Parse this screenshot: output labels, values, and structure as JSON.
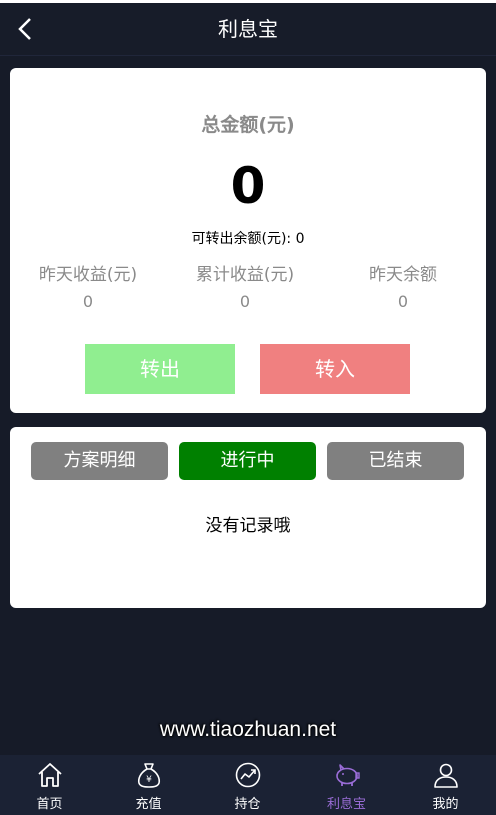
{
  "header": {
    "title": "利息宝"
  },
  "summary": {
    "total_label": "总金额(元)",
    "total_value": "0",
    "transferable_label": "可转出余额(元): 0"
  },
  "stats": [
    {
      "label": "昨天收益(元)",
      "value": "0"
    },
    {
      "label": "累计收益(元)",
      "value": "0"
    },
    {
      "label": "昨天余额",
      "value": "0"
    }
  ],
  "actions": {
    "transfer_out": "转出",
    "transfer_in": "转入"
  },
  "tabs": [
    "方案明细",
    "进行中",
    "已结束"
  ],
  "empty_text": "没有记录哦",
  "watermark": "www.tiaozhuan.net",
  "nav": [
    {
      "label": "首页",
      "icon": "home-icon"
    },
    {
      "label": "充值",
      "icon": "money-bag-icon"
    },
    {
      "label": "持仓",
      "icon": "chart-icon"
    },
    {
      "label": "利息宝",
      "icon": "piggy-bank-icon"
    },
    {
      "label": "我的",
      "icon": "user-icon"
    }
  ],
  "colors": {
    "background": "#161b28",
    "transfer_out": "#90ee90",
    "transfer_in": "#f08080",
    "tab_active": "#008000",
    "tab_inactive": "#808080",
    "nav_active": "#9a6dd7"
  }
}
